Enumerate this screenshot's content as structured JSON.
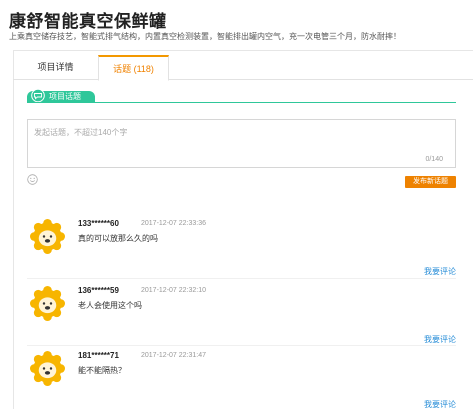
{
  "page": {
    "title": "康舒智能真空保鲜罐",
    "subtitle": "上乘真空储存技艺，智能式排气结构，内置真空检测装置，智能排出罐内空气，充一次电管三个月，防水耐摔！"
  },
  "tabs": [
    {
      "label": "项目详情",
      "active": false
    },
    {
      "label": "话题 (118)",
      "active": true
    }
  ],
  "section": {
    "label": "项目话题"
  },
  "composer": {
    "placeholder": "发起话题，不超过140个字",
    "counter": "0/140",
    "submit_label": "发布新话题"
  },
  "comments": [
    {
      "user": "133******60",
      "time": "2017-12-07 22:33:36",
      "text": "真的可以放那么久的吗",
      "reply_label": "我要评论"
    },
    {
      "user": "136******59",
      "time": "2017-12-07 22:32:10",
      "text": "老人会使用这个吗",
      "reply_label": "我要评论"
    },
    {
      "user": "181******71",
      "time": "2017-12-07 22:31:47",
      "text": "能不能隔热？",
      "reply_label": "我要评论"
    }
  ],
  "colors": {
    "accent": "#f39800",
    "section": "#2fc79a",
    "link": "#2b8fd8",
    "button": "#ee8200"
  }
}
